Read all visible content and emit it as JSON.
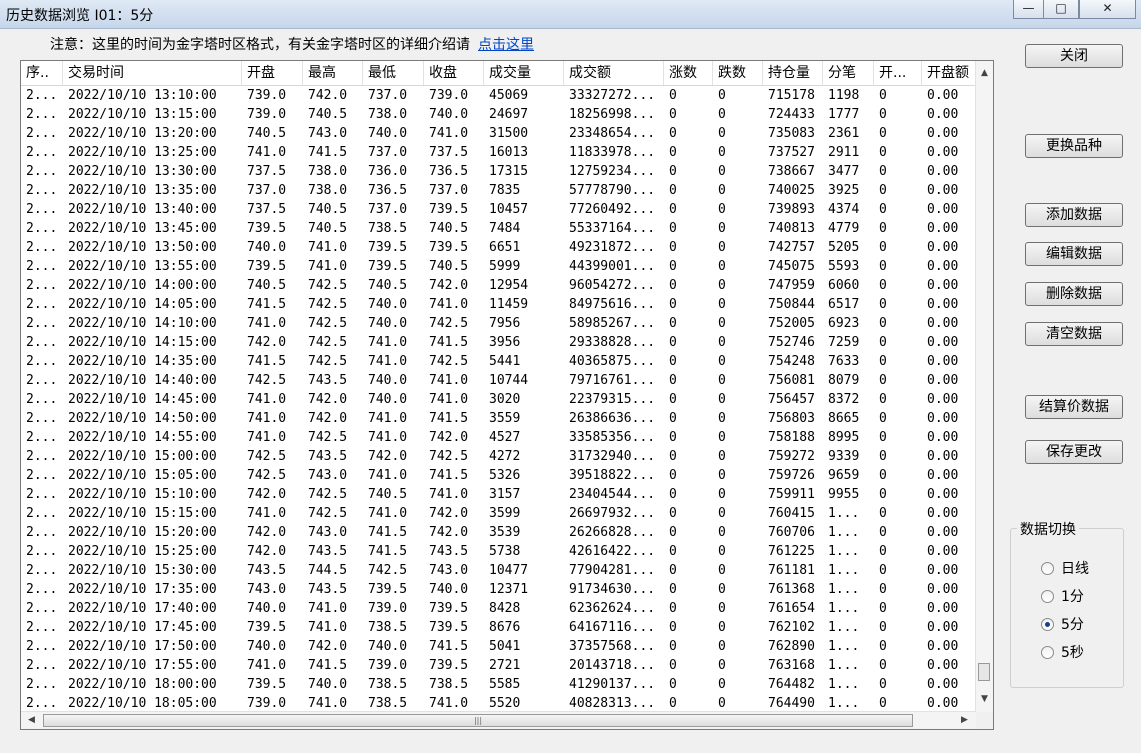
{
  "window": {
    "title": "历史数据浏览 I01：5分",
    "controls": {
      "minimize": "—",
      "maximize": "□",
      "close": "✕"
    }
  },
  "notice": {
    "text": "注意：这里的时间为金字塔时区格式，有关金字塔时区的详细介绍请",
    "link": "点击这里"
  },
  "grid": {
    "columns": [
      "序..",
      "交易时间",
      "开盘",
      "最高",
      "最低",
      "收盘",
      "成交量",
      "成交额",
      "涨数",
      "跌数",
      "持仓量",
      "分笔",
      "开...",
      "开盘额"
    ],
    "rows": [
      [
        "2...",
        "2022/10/10 13:10:00",
        "739.0",
        "742.0",
        "737.0",
        "739.0",
        "45069",
        "33327272...",
        "0",
        "0",
        "715178",
        "1198",
        "0",
        "0.00"
      ],
      [
        "2...",
        "2022/10/10 13:15:00",
        "739.0",
        "740.5",
        "738.0",
        "740.0",
        "24697",
        "18256998...",
        "0",
        "0",
        "724433",
        "1777",
        "0",
        "0.00"
      ],
      [
        "2...",
        "2022/10/10 13:20:00",
        "740.5",
        "743.0",
        "740.0",
        "741.0",
        "31500",
        "23348654...",
        "0",
        "0",
        "735083",
        "2361",
        "0",
        "0.00"
      ],
      [
        "2...",
        "2022/10/10 13:25:00",
        "741.0",
        "741.5",
        "737.0",
        "737.5",
        "16013",
        "11833978...",
        "0",
        "0",
        "737527",
        "2911",
        "0",
        "0.00"
      ],
      [
        "2...",
        "2022/10/10 13:30:00",
        "737.5",
        "738.0",
        "736.0",
        "736.5",
        "17315",
        "12759234...",
        "0",
        "0",
        "738667",
        "3477",
        "0",
        "0.00"
      ],
      [
        "2...",
        "2022/10/10 13:35:00",
        "737.0",
        "738.0",
        "736.5",
        "737.0",
        "7835",
        "57778790...",
        "0",
        "0",
        "740025",
        "3925",
        "0",
        "0.00"
      ],
      [
        "2...",
        "2022/10/10 13:40:00",
        "737.5",
        "740.5",
        "737.0",
        "739.5",
        "10457",
        "77260492...",
        "0",
        "0",
        "739893",
        "4374",
        "0",
        "0.00"
      ],
      [
        "2...",
        "2022/10/10 13:45:00",
        "739.5",
        "740.5",
        "738.5",
        "740.5",
        "7484",
        "55337164...",
        "0",
        "0",
        "740813",
        "4779",
        "0",
        "0.00"
      ],
      [
        "2...",
        "2022/10/10 13:50:00",
        "740.0",
        "741.0",
        "739.5",
        "739.5",
        "6651",
        "49231872...",
        "0",
        "0",
        "742757",
        "5205",
        "0",
        "0.00"
      ],
      [
        "2...",
        "2022/10/10 13:55:00",
        "739.5",
        "741.0",
        "739.5",
        "740.5",
        "5999",
        "44399001...",
        "0",
        "0",
        "745075",
        "5593",
        "0",
        "0.00"
      ],
      [
        "2...",
        "2022/10/10 14:00:00",
        "740.5",
        "742.5",
        "740.5",
        "742.0",
        "12954",
        "96054272...",
        "0",
        "0",
        "747959",
        "6060",
        "0",
        "0.00"
      ],
      [
        "2...",
        "2022/10/10 14:05:00",
        "741.5",
        "742.5",
        "740.0",
        "741.0",
        "11459",
        "84975616...",
        "0",
        "0",
        "750844",
        "6517",
        "0",
        "0.00"
      ],
      [
        "2...",
        "2022/10/10 14:10:00",
        "741.0",
        "742.5",
        "740.0",
        "742.5",
        "7956",
        "58985267...",
        "0",
        "0",
        "752005",
        "6923",
        "0",
        "0.00"
      ],
      [
        "2...",
        "2022/10/10 14:15:00",
        "742.0",
        "742.5",
        "741.0",
        "741.5",
        "3956",
        "29338828...",
        "0",
        "0",
        "752746",
        "7259",
        "0",
        "0.00"
      ],
      [
        "2...",
        "2022/10/10 14:35:00",
        "741.5",
        "742.5",
        "741.0",
        "742.5",
        "5441",
        "40365875...",
        "0",
        "0",
        "754248",
        "7633",
        "0",
        "0.00"
      ],
      [
        "2...",
        "2022/10/10 14:40:00",
        "742.5",
        "743.5",
        "740.0",
        "741.0",
        "10744",
        "79716761...",
        "0",
        "0",
        "756081",
        "8079",
        "0",
        "0.00"
      ],
      [
        "2...",
        "2022/10/10 14:45:00",
        "741.0",
        "742.0",
        "740.0",
        "741.0",
        "3020",
        "22379315...",
        "0",
        "0",
        "756457",
        "8372",
        "0",
        "0.00"
      ],
      [
        "2...",
        "2022/10/10 14:50:00",
        "741.0",
        "742.0",
        "741.0",
        "741.5",
        "3559",
        "26386636...",
        "0",
        "0",
        "756803",
        "8665",
        "0",
        "0.00"
      ],
      [
        "2...",
        "2022/10/10 14:55:00",
        "741.0",
        "742.5",
        "741.0",
        "742.0",
        "4527",
        "33585356...",
        "0",
        "0",
        "758188",
        "8995",
        "0",
        "0.00"
      ],
      [
        "2...",
        "2022/10/10 15:00:00",
        "742.5",
        "743.5",
        "742.0",
        "742.5",
        "4272",
        "31732940...",
        "0",
        "0",
        "759272",
        "9339",
        "0",
        "0.00"
      ],
      [
        "2...",
        "2022/10/10 15:05:00",
        "742.5",
        "743.0",
        "741.0",
        "741.5",
        "5326",
        "39518822...",
        "0",
        "0",
        "759726",
        "9659",
        "0",
        "0.00"
      ],
      [
        "2...",
        "2022/10/10 15:10:00",
        "742.0",
        "742.5",
        "740.5",
        "741.0",
        "3157",
        "23404544...",
        "0",
        "0",
        "759911",
        "9955",
        "0",
        "0.00"
      ],
      [
        "2...",
        "2022/10/10 15:15:00",
        "741.0",
        "742.5",
        "741.0",
        "742.0",
        "3599",
        "26697932...",
        "0",
        "0",
        "760415",
        "1...",
        "0",
        "0.00"
      ],
      [
        "2...",
        "2022/10/10 15:20:00",
        "742.0",
        "743.0",
        "741.5",
        "742.0",
        "3539",
        "26266828...",
        "0",
        "0",
        "760706",
        "1...",
        "0",
        "0.00"
      ],
      [
        "2...",
        "2022/10/10 15:25:00",
        "742.0",
        "743.5",
        "741.5",
        "743.5",
        "5738",
        "42616422...",
        "0",
        "0",
        "761225",
        "1...",
        "0",
        "0.00"
      ],
      [
        "2...",
        "2022/10/10 15:30:00",
        "743.5",
        "744.5",
        "742.5",
        "743.0",
        "10477",
        "77904281...",
        "0",
        "0",
        "761181",
        "1...",
        "0",
        "0.00"
      ],
      [
        "2...",
        "2022/10/10 17:35:00",
        "743.0",
        "743.5",
        "739.5",
        "740.0",
        "12371",
        "91734630...",
        "0",
        "0",
        "761368",
        "1...",
        "0",
        "0.00"
      ],
      [
        "2...",
        "2022/10/10 17:40:00",
        "740.0",
        "741.0",
        "739.0",
        "739.5",
        "8428",
        "62362624...",
        "0",
        "0",
        "761654",
        "1...",
        "0",
        "0.00"
      ],
      [
        "2...",
        "2022/10/10 17:45:00",
        "739.5",
        "741.0",
        "738.5",
        "739.5",
        "8676",
        "64167116...",
        "0",
        "0",
        "762102",
        "1...",
        "0",
        "0.00"
      ],
      [
        "2...",
        "2022/10/10 17:50:00",
        "740.0",
        "742.0",
        "740.0",
        "741.5",
        "5041",
        "37357568...",
        "0",
        "0",
        "762890",
        "1...",
        "0",
        "0.00"
      ],
      [
        "2...",
        "2022/10/10 17:55:00",
        "741.0",
        "741.5",
        "739.0",
        "739.5",
        "2721",
        "20143718...",
        "0",
        "0",
        "763168",
        "1...",
        "0",
        "0.00"
      ],
      [
        "2...",
        "2022/10/10 18:00:00",
        "739.5",
        "740.0",
        "738.5",
        "738.5",
        "5585",
        "41290137...",
        "0",
        "0",
        "764482",
        "1...",
        "0",
        "0.00"
      ],
      [
        "2...",
        "2022/10/10 18:05:00",
        "739.0",
        "741.0",
        "738.5",
        "741.0",
        "5520",
        "40828313...",
        "0",
        "0",
        "764490",
        "1...",
        "0",
        "0.00"
      ]
    ]
  },
  "buttons": {
    "close": "关闭",
    "change_variety": "更换品种",
    "add_data": "添加数据",
    "edit_data": "编辑数据",
    "delete_data": "删除数据",
    "clear_data": "清空数据",
    "settlement_data": "结算价数据",
    "save_changes": "保存更改"
  },
  "switch_group": {
    "title": "数据切换",
    "options": [
      "日线",
      "1分",
      "5分",
      "5秒"
    ],
    "selected": "5分"
  }
}
